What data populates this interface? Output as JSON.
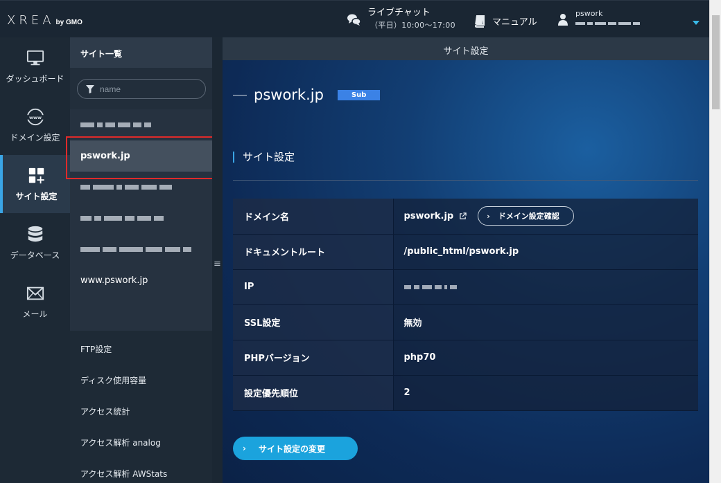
{
  "header": {
    "logo_main": "XREA",
    "logo_sub": "by GMO",
    "chat_label": "ライブチャット",
    "chat_hours": "（平日）10:00〜17:00",
    "manual_label": "マニュアル",
    "user_name": "pswork"
  },
  "leftnav": {
    "items": [
      {
        "label": "ダッシュボード"
      },
      {
        "label": "ドメイン設定"
      },
      {
        "label": "サイト設定"
      },
      {
        "label": "データベース"
      },
      {
        "label": "メール"
      }
    ]
  },
  "sitepanel": {
    "title": "サイト一覧",
    "filter_placeholder": "name",
    "selected_site": "pswork.jp",
    "other_site": "www.pswork.jp",
    "menu": [
      "FTP設定",
      "ディスク使用容量",
      "アクセス統計",
      "アクセス解析 analog",
      "アクセス解析 AWStats"
    ]
  },
  "main": {
    "header": "サイト設定",
    "site_name": "pswork.jp",
    "badge": "Sub",
    "section_title": "サイト設定",
    "rows": [
      {
        "label": "ドメイン名",
        "value": "pswork.jp"
      },
      {
        "label": "ドキュメントルート",
        "value": "/public_html/pswork.jp"
      },
      {
        "label": "IP",
        "value": ""
      },
      {
        "label": "SSL設定",
        "value": "無効"
      },
      {
        "label": "PHPバージョン",
        "value": "php70"
      },
      {
        "label": "設定優先順位",
        "value": "2"
      }
    ],
    "domain_confirm_button": "ドメイン設定確認",
    "change_button": "サイト設定の変更"
  },
  "colors": {
    "accent": "#1ba3dd",
    "badge": "#3b82e6",
    "highlight": "#e02a2a"
  }
}
